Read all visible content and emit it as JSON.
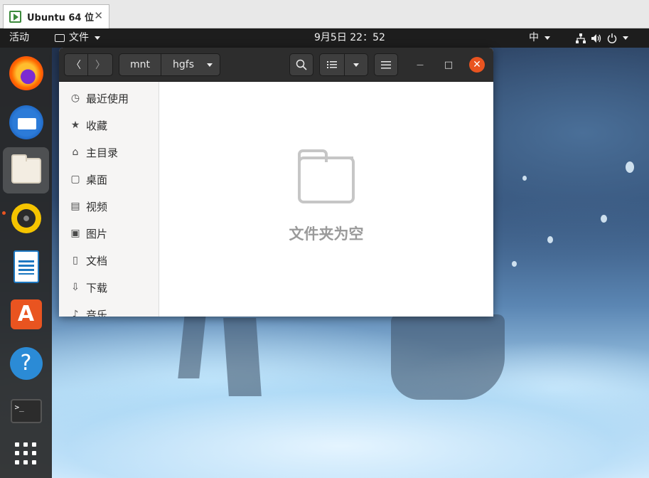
{
  "host": {
    "tab_title": "Ubuntu 64 位",
    "tab_close": "✕"
  },
  "topbar": {
    "activities": "活动",
    "app_menu": "文件",
    "clock": "9月5日  22：52",
    "input_method": "中"
  },
  "dock": {
    "items": [
      "firefox",
      "thunderbird",
      "files",
      "rhythmbox",
      "libreoffice-writer",
      "ubuntu-software",
      "help",
      "terminal",
      "show-applications"
    ],
    "active": "files",
    "terminal_prompt": ">_"
  },
  "window": {
    "path": [
      "mnt",
      "hgfs"
    ],
    "back": "〈",
    "forward": "〉",
    "menu_glyph": "☰",
    "search_glyph": "⌕",
    "list_glyph": "☷",
    "minimize_glyph": "—",
    "maximize_glyph": "□",
    "close_glyph": "✕",
    "sidebar": [
      {
        "label": "最近使用",
        "icon": "clock-icon",
        "glyph": "◷"
      },
      {
        "label": "收藏",
        "icon": "star-icon",
        "glyph": "★"
      },
      {
        "label": "主目录",
        "icon": "home-icon",
        "glyph": "⌂"
      },
      {
        "label": "桌面",
        "icon": "desktop-icon",
        "glyph": "▢"
      },
      {
        "label": "视频",
        "icon": "video-icon",
        "glyph": "▤"
      },
      {
        "label": "图片",
        "icon": "picture-icon",
        "glyph": "▣"
      },
      {
        "label": "文档",
        "icon": "document-icon",
        "glyph": "▯"
      },
      {
        "label": "下载",
        "icon": "download-icon",
        "glyph": "⇩"
      },
      {
        "label": "音乐",
        "icon": "music-icon",
        "glyph": "♪"
      }
    ],
    "empty_message": "文件夹为空"
  },
  "colors": {
    "accent": "#e95420",
    "topbar": "#1d1d1d",
    "headerbar": "#2d2d2d"
  }
}
